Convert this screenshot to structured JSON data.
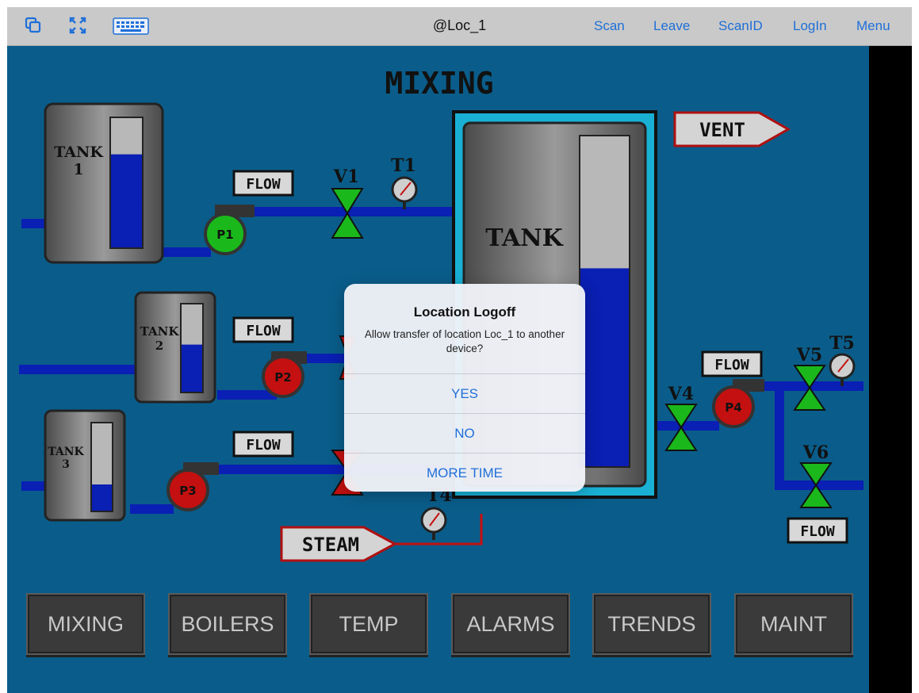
{
  "topbar": {
    "title": "@Loc_1",
    "links": [
      "Scan",
      "Leave",
      "ScanID",
      "LogIn",
      "Menu"
    ],
    "icons": [
      "copy-icon",
      "fullscreen-icon",
      "keyboard-icon"
    ]
  },
  "screen": {
    "title": "MIXING",
    "tanks": {
      "tank1": "TANK\n1",
      "tank2": "TANK\n2",
      "tank3": "TANK\n3",
      "main": "TANK"
    },
    "tank_levels": {
      "tank1": 0.72,
      "tank2": 0.54,
      "tank3": 0.3,
      "main": 0.6
    },
    "pumps": {
      "p1": "P1",
      "p2": "P2",
      "p3": "P3",
      "p4": "P4"
    },
    "pump_colors": {
      "running": "#1bb81b",
      "stopped": "#c41010"
    },
    "valves": {
      "v1": "V1",
      "v4": "V4",
      "v5": "V5",
      "v6": "V6"
    },
    "temps": {
      "t1": "T1",
      "t4": "T4",
      "t5": "T5"
    },
    "flow_label": "FLOW",
    "vent_label": "VENT",
    "steam_label": "STEAM",
    "nav": [
      "MIXING",
      "BOILERS",
      "TEMP",
      "ALARMS",
      "TRENDS",
      "MAINT"
    ]
  },
  "dialog": {
    "title": "Location Logoff",
    "message": "Allow transfer of location Loc_1 to another device?",
    "buttons": [
      "YES",
      "NO",
      "MORE TIME"
    ]
  }
}
